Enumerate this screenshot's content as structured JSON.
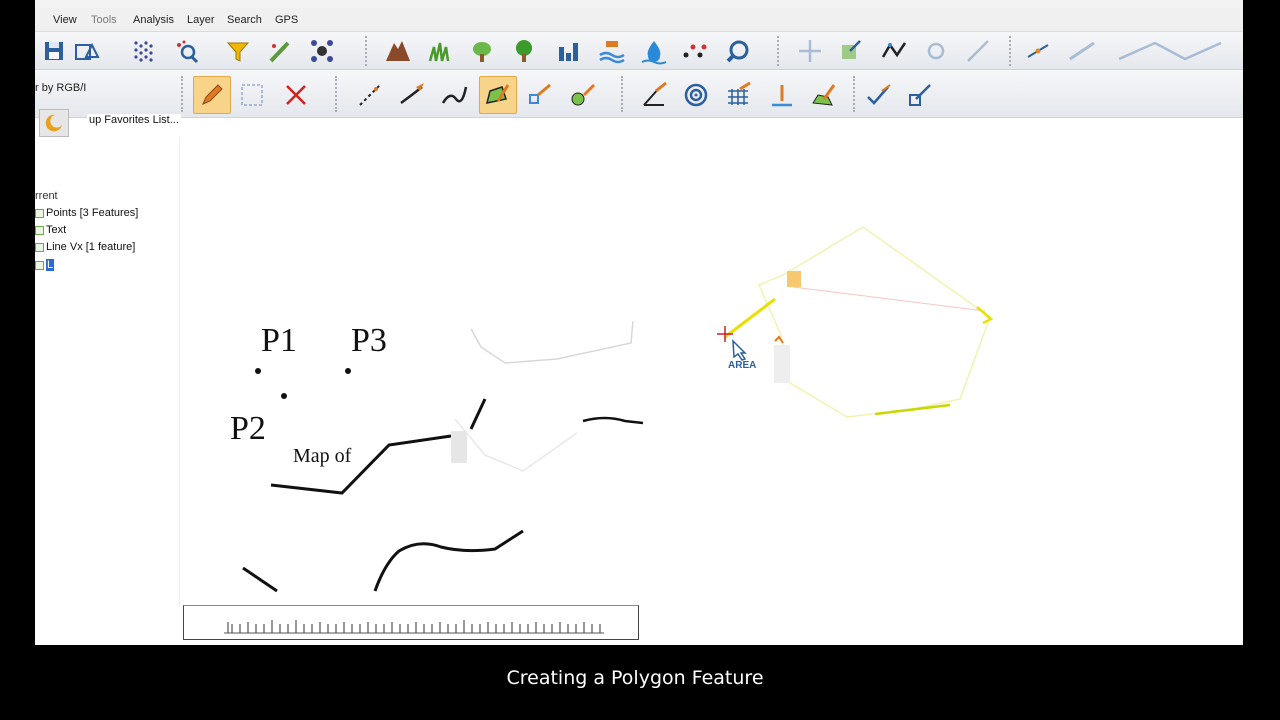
{
  "menubar": {
    "items": [
      "View",
      "Tools",
      "Analysis",
      "Layer",
      "Search",
      "GPS"
    ]
  },
  "toolbar1": {
    "icons": [
      "save-icon",
      "export-map-icon",
      "grid-dots-icon",
      "search-zoom-icon",
      "filter-funnel-icon",
      "digitize-pen-icon",
      "network-icon",
      "mountain-icon",
      "grass-icon",
      "tree-icon",
      "tree-2-icon",
      "building-icon",
      "coastline-icon",
      "water-drop-icon",
      "dots-icon",
      "tools-icon",
      "move-icon",
      "scale-icon",
      "vertex-icon",
      "node-icon",
      "snap-icon",
      "cut-icon",
      "measure-icon"
    ]
  },
  "toolbar2": {
    "rgb_label": "r by RGB/I",
    "icons": [
      "edit-pencil-icon",
      "select-box-icon",
      "delete-x-icon",
      "create-point-line-icon",
      "create-line-icon",
      "create-curve-icon",
      "create-area-icon",
      "draw-line-icon",
      "create-circle-icon",
      "measure-angle-icon",
      "target-icon",
      "grid-icon",
      "insert-vertex-icon",
      "edit-area-icon",
      "check-icon",
      "edit-tool-icon"
    ]
  },
  "favorites": {
    "label": "up Favorites List..."
  },
  "layers": {
    "header": "rrent",
    "items": [
      {
        "name": "Points [3 Features]"
      },
      {
        "name": "Text"
      },
      {
        "name": "Line Vx [1 feature]"
      },
      {
        "name": "L"
      }
    ]
  },
  "map": {
    "labels": {
      "p1": "P1",
      "p2": "P2",
      "p3": "P3",
      "map_of": "Map of"
    },
    "cursor_label": "AREA"
  },
  "caption": "Creating a Polygon Feature",
  "colors": {
    "toolbar_active": "#f8d48a",
    "digitize_line": "#e8e000",
    "caption_bg": "#000000",
    "selected_layer": "#2a6bd2"
  }
}
